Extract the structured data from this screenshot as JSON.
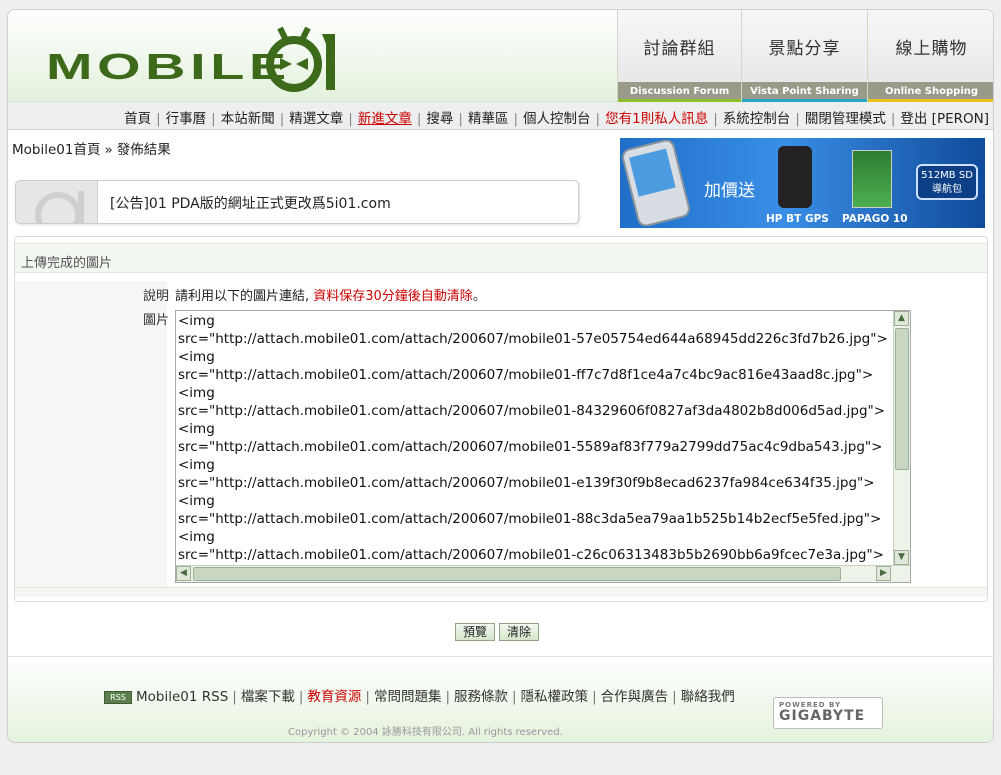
{
  "header": {
    "logo_text": "MOBILE",
    "tabs": [
      {
        "zh": "討論群組",
        "en": "Discussion Forum",
        "bar_color": "#8cbf2a"
      },
      {
        "zh": "景點分享",
        "en": "Vista Point Sharing",
        "bar_color": "#28a6c4"
      },
      {
        "zh": "線上購物",
        "en": "Online Shopping",
        "bar_color": "#e8c21c"
      }
    ]
  },
  "menu": {
    "home": "首頁",
    "calendar": "行事曆",
    "news": "本站新聞",
    "featured": "精選文章",
    "new_posts": "新進文章",
    "search": "搜尋",
    "essence": "精華區",
    "control_panel": "個人控制台",
    "pm_notice": "您有1則私人訊息",
    "sys_panel": "系統控制台",
    "admin_mode": "關閉管理模式",
    "logout": "登出 [PERON]"
  },
  "breadcrumb": {
    "home": "Mobile01首頁",
    "separator": "»",
    "current": "發佈結果"
  },
  "notice": {
    "text": "[公告]01 PDA版的網址正式更改爲5i01.com"
  },
  "ad": {
    "plus_text": "加價送",
    "gps_label": "HP BT GPS",
    "papago_label": "PAPAGO 10",
    "sd_label": "512MB SD 導航包"
  },
  "panel": {
    "title": "上傳完成的圖片",
    "desc_label": "說明",
    "desc_text": "請利用以下的圖片連結, ",
    "desc_warning": "資料保存30分鐘後自動清除",
    "desc_end": "。",
    "image_label": "圖片",
    "textarea_lines": [
      "<img",
      "src=\"http://attach.mobile01.com/attach/200607/mobile01-57e05754ed644a68945dd226c3fd7b26.jpg\">",
      "<img",
      "src=\"http://attach.mobile01.com/attach/200607/mobile01-ff7c7d8f1ce4a7c4bc9ac816e43aad8c.jpg\">",
      "<img",
      "src=\"http://attach.mobile01.com/attach/200607/mobile01-84329606f0827af3da4802b8d006d5ad.jpg\">",
      "<img",
      "src=\"http://attach.mobile01.com/attach/200607/mobile01-5589af83f779a2799dd75ac4c9dba543.jpg\">",
      "<img",
      "src=\"http://attach.mobile01.com/attach/200607/mobile01-e139f30f9b8ecad6237fa984ce634f35.jpg\">",
      "<img",
      "src=\"http://attach.mobile01.com/attach/200607/mobile01-88c3da5ea79aa1b525b14b2ecf5e5fed.jpg\">",
      "<img",
      "src=\"http://attach.mobile01.com/attach/200607/mobile01-c26c06313483b5b2690bb6a9fcec7e3a.jpg\">"
    ]
  },
  "buttons": {
    "preview": "預覽",
    "clear": "清除"
  },
  "footer": {
    "rss_badge": "RSS",
    "rss": "Mobile01 RSS",
    "download": "檔案下載",
    "education": "教育資源",
    "faq": "常問問題集",
    "terms": "服務條款",
    "privacy": "隱私權政策",
    "ads": "合作與廣告",
    "contact": "聯絡我們",
    "copyright": "Copyright © 2004 詠勝科技有限公司. All rights reserved.",
    "powered_by": "POWERED BY",
    "sponsor": "GIGABYTE"
  }
}
